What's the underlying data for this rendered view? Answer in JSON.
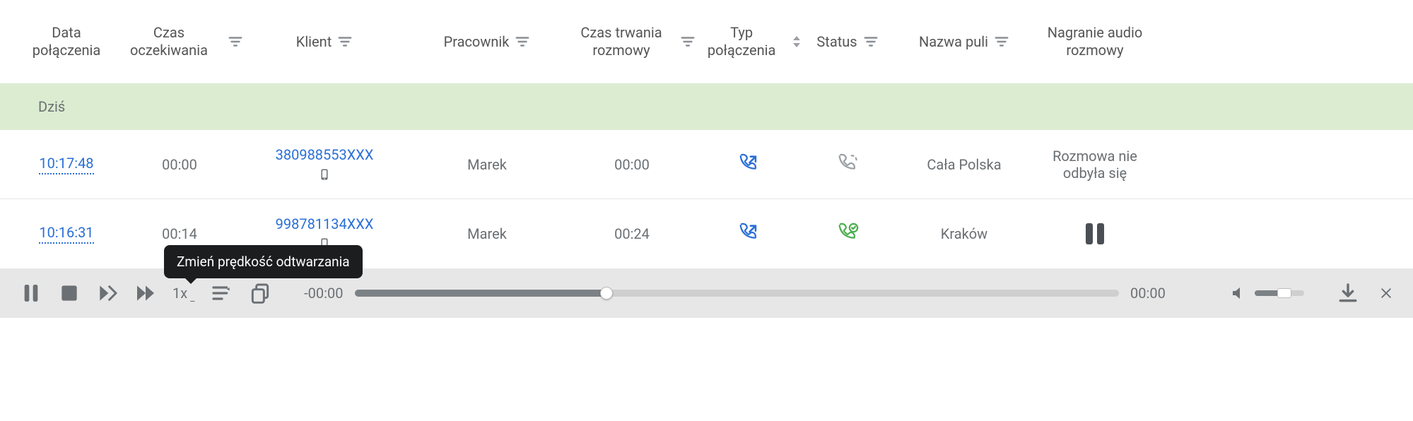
{
  "columns": {
    "date": "Data połączenia",
    "wait": "Czas oczekiwania",
    "client": "Klient",
    "employee": "Pracownik",
    "duration": "Czas trwania rozmowy",
    "type": "Typ połączenia",
    "status": "Status",
    "pool": "Nazwa puli",
    "recording": "Nagranie audio rozmowy"
  },
  "group_label": "Dziś",
  "rows": [
    {
      "time": "10:17:48",
      "wait": "00:00",
      "client": "380988553XXX",
      "employee": "Marek",
      "duration": "00:00",
      "type_icon": "outgoing-call",
      "status_icon": "missed-call",
      "status_color": "#9ca0a4",
      "pool": "Cała Polska",
      "recording_text": "Rozmowa nie odbyła się",
      "recording_mode": "text"
    },
    {
      "time": "10:16:31",
      "wait": "00:14",
      "client": "998781134XXX",
      "employee": "Marek",
      "duration": "00:24",
      "type_icon": "outgoing-call",
      "status_icon": "answered-call",
      "status_color": "#4caf50",
      "pool": "Kraków",
      "recording_text": "",
      "recording_mode": "pause"
    }
  ],
  "player": {
    "speed_label": "1x",
    "time_left": "-00:00",
    "time_right": "00:00",
    "tooltip": "Zmień prędkość odtwarzania"
  }
}
